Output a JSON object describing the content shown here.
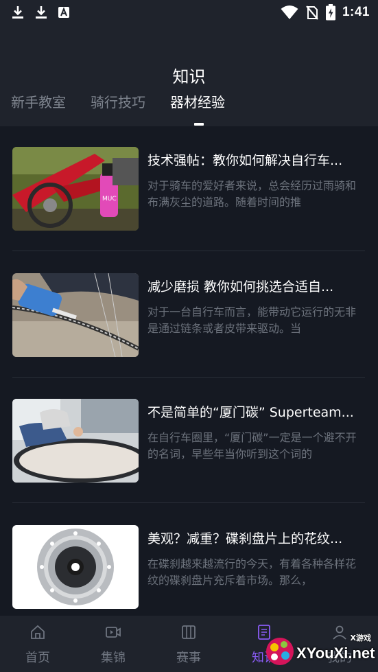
{
  "status_bar": {
    "time": "1:41",
    "left_icons": [
      "download-icon",
      "download-icon",
      "app-a-icon"
    ],
    "right_icons": [
      "wifi-icon",
      "no-sim-icon",
      "battery-charging-icon"
    ]
  },
  "header": {
    "title": "知识",
    "tabs": [
      {
        "label": "新手教室",
        "active": false
      },
      {
        "label": "骑行技巧",
        "active": false
      },
      {
        "label": "器材经验",
        "active": true
      }
    ]
  },
  "articles": [
    {
      "title": "技术强帖：教你如何解决自行车...",
      "excerpt": "对于骑车的爱好者来说，总会经历过雨骑和布满灰尘的道路。随着时间的推",
      "thumbnail": "bike-cleaning-spray-photo"
    },
    {
      "title": "减少磨损 教你如何挑选合适自...",
      "excerpt": "对于一台自行车而言，能带动它运行的无非是通过链条或者皮带来驱动。当",
      "thumbnail": "chain-lube-photo"
    },
    {
      "title": "不是简单的“厦门碳” Superteam...",
      "excerpt": "在自行车圈里，“厦门碳”一定是一个避不开的名词，早些年当你听到这个词的",
      "thumbnail": "carbon-rim-factory-photo"
    },
    {
      "title": "美观？减重？碟刹盘片上的花纹...",
      "excerpt": "在碟刹越来越流行的今天，有着各种各样花纹的碟刹盘片充斥着市场。那么，",
      "thumbnail": "disc-brake-rotor-photo"
    }
  ],
  "bottom_nav": [
    {
      "label": "首页",
      "icon": "home-icon",
      "active": false
    },
    {
      "label": "集锦",
      "icon": "video-icon",
      "active": false
    },
    {
      "label": "赛事",
      "icon": "map-icon",
      "active": false
    },
    {
      "label": "知识",
      "icon": "document-icon",
      "active": true
    },
    {
      "label": "我的",
      "icon": "user-icon",
      "active": false
    }
  ],
  "watermark": {
    "text": "XYouXi.net",
    "small": "X游戏"
  },
  "colors": {
    "background": "#151922",
    "header": "#1f232c",
    "active_tab": "#ffffff",
    "inactive_tab": "#7f858f",
    "active_nav": "#8a5cf5"
  }
}
